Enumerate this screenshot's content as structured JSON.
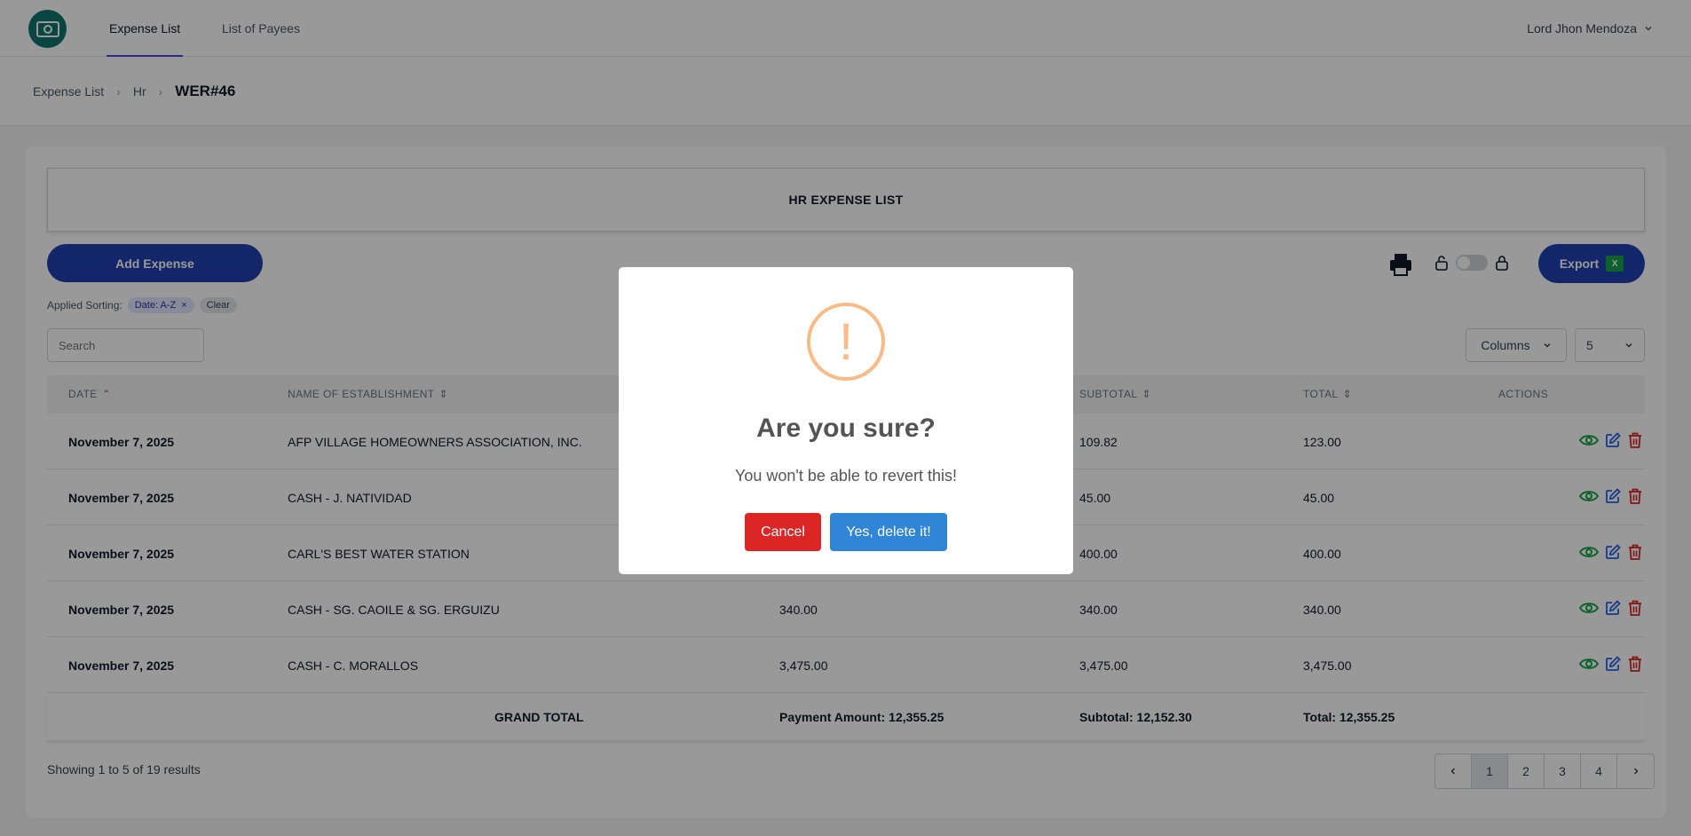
{
  "nav": {
    "tabs": [
      "Expense List",
      "List of Payees"
    ],
    "user": "Lord Jhon Mendoza"
  },
  "breadcrumb": [
    "Expense List",
    "Hr",
    "WER#46"
  ],
  "page": {
    "title": "HR EXPENSE LIST",
    "add_button": "Add Expense",
    "export_button": "Export",
    "sorting_label": "Applied Sorting:",
    "sort_chip": "Date: A-Z",
    "clear_chip": "Clear",
    "search_placeholder": "Search",
    "columns_button": "Columns",
    "per_page": "5"
  },
  "table": {
    "headers": [
      "DATE",
      "NAME OF ESTABLISHMENT",
      "SUBTOTAL",
      "TOTAL",
      "ACTIONS"
    ],
    "rows": [
      {
        "date": "November 7, 2025",
        "name": "AFP VILLAGE HOMEOWNERS ASSOCIATION, INC.",
        "payment": "",
        "subtotal": "109.82",
        "total": "123.00"
      },
      {
        "date": "November 7, 2025",
        "name": "CASH - J. NATIVIDAD",
        "payment": "",
        "subtotal": "45.00",
        "total": "45.00"
      },
      {
        "date": "November 7, 2025",
        "name": "CARL'S BEST WATER STATION",
        "payment": "",
        "subtotal": "400.00",
        "total": "400.00"
      },
      {
        "date": "November 7, 2025",
        "name": "CASH - SG. CAOILE & SG. ERGUIZU",
        "payment": "340.00",
        "subtotal": "340.00",
        "total": "340.00"
      },
      {
        "date": "November 7, 2025",
        "name": "CASH - C. MORALLOS",
        "payment": "3,475.00",
        "subtotal": "3,475.00",
        "total": "3,475.00"
      }
    ],
    "footer": {
      "label": "GRAND TOTAL",
      "payment": "Payment Amount: 12,355.25",
      "subtotal": "Subtotal: 12,152.30",
      "total": "Total: 12,355.25"
    }
  },
  "pagination": {
    "summary": "Showing 1 to 5 of 19 results",
    "pages": [
      "1",
      "2",
      "3",
      "4"
    ],
    "current": "1"
  },
  "modal": {
    "title": "Are you sure?",
    "text": "You won't be able to revert this!",
    "cancel": "Cancel",
    "confirm": "Yes, delete it!"
  },
  "colors": {
    "primary": "#1e40af",
    "danger": "#dc2626",
    "confirm": "#3085d6",
    "warning": "#f8bb86",
    "view_icon": "#16a34a",
    "edit_icon": "#2563eb",
    "delete_icon": "#dc2626"
  }
}
